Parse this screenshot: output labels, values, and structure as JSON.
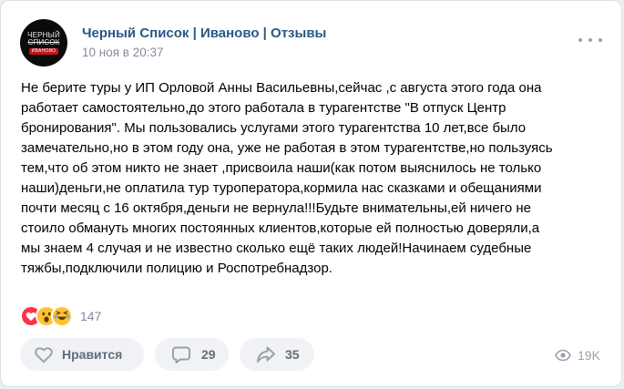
{
  "post": {
    "group_name": "Черный Список | Иваново | Отзывы",
    "date": "10 ноя в 20:37",
    "avatar": {
      "line1": "ЧЕРНЫЙ",
      "line2": "СПИСОК",
      "line3": "ИВАНОВО"
    },
    "text": "Не берите туры у ИП Орловой Анны Васильевны,сейчас ,с августа этого года она\nработает самостоятельно,до этого работала в турагентстве \"В отпуск Центр\nбронирования\". Мы пользовались услугами этого турагентства 10 лет,все было\nзамечательно,но в этом году она, уже не работая в этом турагентстве,но пользуясь\nтем,что об этом никто не знает ,присвоила наши(как потом выяснилось не только\nнаши)деньги,не оплатила тур туроператора,кормила нас сказками и обещаниями\nпочти месяц с 16 октября,деньги не вернула!!!Будьте внимательны,ей ничего не\nстоило обмануть многих постоянных клиентов,которые ей полностью доверяли,а\nмы знаем 4 случая и не известно сколько ещё таких людей!Начинаем судебные\nтяжбы,подключили полицию и Роспотребнадзор."
  },
  "reactions": {
    "icons": [
      "heart-reaction",
      "surprised-reaction",
      "laughing-reaction"
    ],
    "count": "147"
  },
  "actions": {
    "like_label": "Нравится",
    "comments_count": "29",
    "shares_count": "35"
  },
  "views": {
    "count": "19K",
    "icon": "eye-icon"
  },
  "colors": {
    "link": "#2a5885",
    "muted": "#818c99",
    "button_bg": "#f0f2f5",
    "heart": "#ff3347"
  }
}
